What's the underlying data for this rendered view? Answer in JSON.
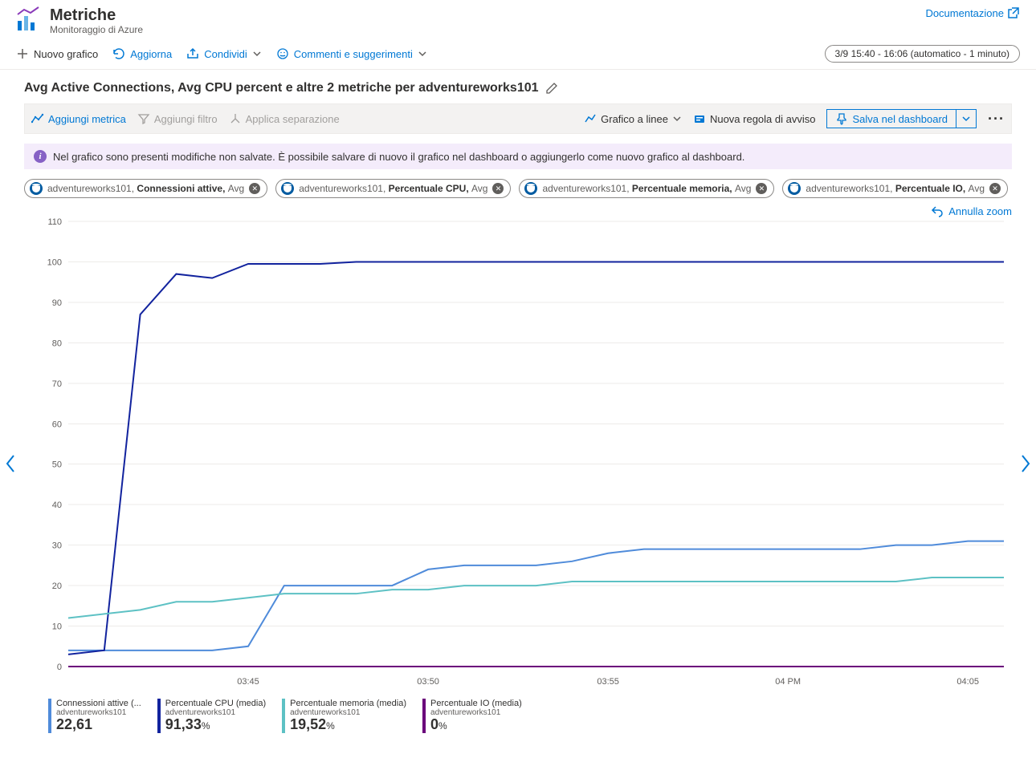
{
  "header": {
    "title": "Metriche",
    "subtitle": "Monitoraggio di Azure",
    "doc_link": "Documentazione"
  },
  "cmdbar": {
    "new_chart": "Nuovo grafico",
    "refresh": "Aggiorna",
    "share": "Condividi",
    "feedback": "Commenti e suggerimenti",
    "time_range": "3/9 15:40 - 16:06 (automatico - 1 minuto)"
  },
  "chart_header": {
    "title": "Avg Active Connections, Avg CPU percent e altre 2 metriche per adventureworks101"
  },
  "chart_toolbar": {
    "add_metric": "Aggiungi metrica",
    "add_filter": "Aggiungi filtro",
    "apply_split": "Applica separazione",
    "chart_type": "Grafico a linee",
    "new_alert": "Nuova regola di avviso",
    "save": "Salva nel dashboard"
  },
  "notice": "Nel grafico sono presenti modifiche non salvate. È possibile salvare di nuovo il grafico nel dashboard o aggiungerlo come nuovo grafico al dashboard.",
  "pills": [
    {
      "scope": "adventureworks101",
      "metric": "Connessioni attive",
      "agg": "Avg"
    },
    {
      "scope": "adventureworks101",
      "metric": "Percentuale CPU",
      "agg": "Avg"
    },
    {
      "scope": "adventureworks101",
      "metric": "Percentuale memoria",
      "agg": "Avg"
    },
    {
      "scope": "adventureworks101",
      "metric": "Percentuale IO",
      "agg": "Avg"
    }
  ],
  "undo_zoom": "Annulla zoom",
  "legend": [
    {
      "label": "Connessioni attive (...",
      "scope": "adventureworks101",
      "value": "22,61",
      "unit": "",
      "color": "#4f8bda"
    },
    {
      "label": "Percentuale CPU (media)",
      "scope": "adventureworks101",
      "value": "91,33",
      "unit": "%",
      "color": "#12239e"
    },
    {
      "label": "Percentuale memoria (media)",
      "scope": "adventureworks101",
      "value": "19,52",
      "unit": "%",
      "color": "#5dc1c4"
    },
    {
      "label": "Percentuale IO (media)",
      "scope": "adventureworks101",
      "value": "0",
      "unit": "%",
      "color": "#6b007b"
    }
  ],
  "chart_data": {
    "type": "line",
    "xlabel": "",
    "ylabel": "",
    "ylim": [
      0,
      110
    ],
    "x_ticks": [
      "03:45",
      "03:50",
      "03:55",
      "04 PM",
      "04:05"
    ],
    "y_ticks": [
      0,
      10,
      20,
      30,
      40,
      50,
      60,
      70,
      80,
      90,
      100,
      110
    ],
    "categories": [
      "15:40",
      "15:41",
      "15:42",
      "15:43",
      "15:44",
      "15:45",
      "15:46",
      "15:47",
      "15:48",
      "15:49",
      "15:50",
      "15:51",
      "15:52",
      "15:53",
      "15:54",
      "15:55",
      "15:56",
      "15:57",
      "15:58",
      "15:59",
      "16:00",
      "16:01",
      "16:02",
      "16:03",
      "16:04",
      "16:05",
      "16:06"
    ],
    "series": [
      {
        "name": "Connessioni attive (media)",
        "color": "#4f8bda",
        "values": [
          4,
          4,
          4,
          4,
          4,
          5,
          20,
          20,
          20,
          20,
          24,
          25,
          25,
          25,
          26,
          28,
          29,
          29,
          29,
          29,
          29,
          29,
          29,
          30,
          30,
          31,
          31
        ]
      },
      {
        "name": "Percentuale CPU (media)",
        "color": "#12239e",
        "values": [
          3,
          4,
          87,
          97,
          96,
          99.5,
          99.5,
          99.5,
          100,
          100,
          100,
          100,
          100,
          100,
          100,
          100,
          100,
          100,
          100,
          100,
          100,
          100,
          100,
          100,
          100,
          100,
          100
        ]
      },
      {
        "name": "Percentuale memoria (media)",
        "color": "#5dc1c4",
        "values": [
          12,
          13,
          14,
          16,
          16,
          17,
          18,
          18,
          18,
          19,
          19,
          20,
          20,
          20,
          21,
          21,
          21,
          21,
          21,
          21,
          21,
          21,
          21,
          21,
          22,
          22,
          22
        ]
      },
      {
        "name": "Percentuale IO (media)",
        "color": "#6b007b",
        "values": [
          0,
          0,
          0,
          0,
          0,
          0,
          0,
          0,
          0,
          0,
          0,
          0,
          0,
          0,
          0,
          0,
          0,
          0,
          0,
          0,
          0,
          0,
          0,
          0,
          0,
          0,
          0
        ]
      }
    ]
  }
}
